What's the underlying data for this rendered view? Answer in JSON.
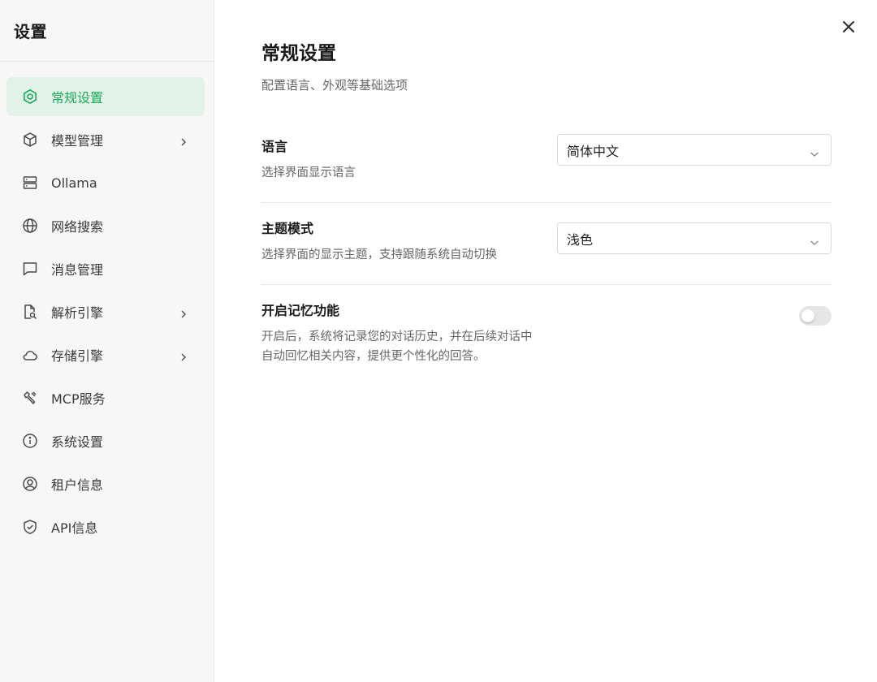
{
  "sidebar": {
    "title": "设置",
    "items": [
      {
        "label": "常规设置",
        "icon": "settings-icon",
        "active": true
      },
      {
        "label": "模型管理",
        "icon": "cube-icon",
        "chevron": true
      },
      {
        "label": "Ollama",
        "icon": "server-icon"
      },
      {
        "label": "网络搜索",
        "icon": "globe-icon"
      },
      {
        "label": "消息管理",
        "icon": "message-icon"
      },
      {
        "label": "解析引擎",
        "icon": "file-search-icon",
        "chevron": true
      },
      {
        "label": "存储引擎",
        "icon": "cloud-icon",
        "chevron": true
      },
      {
        "label": "MCP服务",
        "icon": "tool-icon"
      },
      {
        "label": "系统设置",
        "icon": "info-icon"
      },
      {
        "label": "租户信息",
        "icon": "user-circle-icon"
      },
      {
        "label": "API信息",
        "icon": "shield-check-icon"
      }
    ]
  },
  "main": {
    "title": "常规设置",
    "subtitle": "配置语言、外观等基础选项",
    "settings": {
      "language": {
        "name": "语言",
        "desc": "选择界面显示语言",
        "value": "简体中文"
      },
      "theme": {
        "name": "主题模式",
        "desc": "选择界面的显示主题，支持跟随系统自动切换",
        "value": "浅色"
      },
      "memory": {
        "name": "开启记忆功能",
        "desc": "开启后，系统将记录您的对话历史，并在后续对话中自动回忆相关内容，提供更个性化的回答。",
        "enabled": false
      }
    }
  },
  "colors": {
    "accent": "#1aab5a",
    "active_bg": "#e3f2e8",
    "sidebar_bg": "#f7f7f7"
  }
}
